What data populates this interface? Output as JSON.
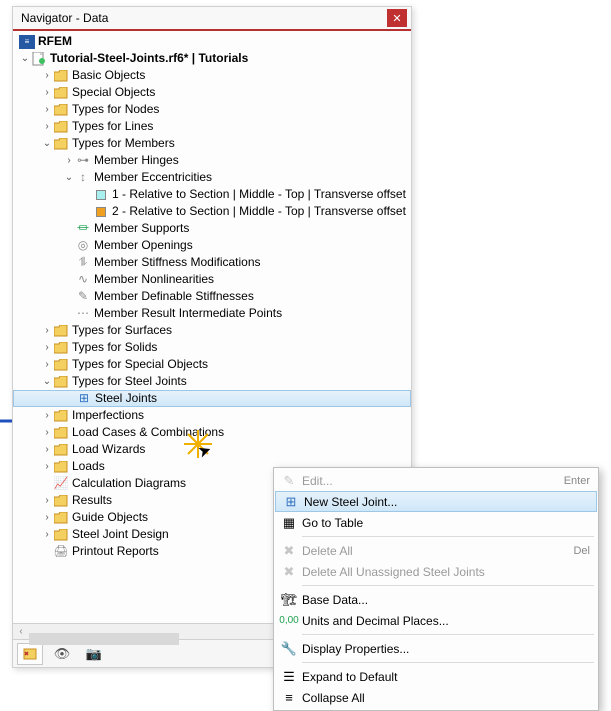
{
  "window": {
    "title": "Navigator - Data"
  },
  "tree": {
    "root_app": "RFEM",
    "project": "Tutorial-Steel-Joints.rf6* | Tutorials",
    "items": {
      "basic_objects": "Basic Objects",
      "special_objects": "Special Objects",
      "types_nodes": "Types for Nodes",
      "types_lines": "Types for Lines",
      "types_members": "Types for Members",
      "member_hinges": "Member Hinges",
      "member_ecc": "Member Eccentricities",
      "ecc1": "1 - Relative to Section | Middle - Top | Transverse offset",
      "ecc2": "2 - Relative to Section | Middle - Top | Transverse offset",
      "member_supports": "Member Supports",
      "member_openings": "Member Openings",
      "member_stiff_mod": "Member Stiffness Modifications",
      "member_nonlin": "Member Nonlinearities",
      "member_def_stiff": "Member Definable Stiffnesses",
      "member_res_int": "Member Result Intermediate Points",
      "types_surfaces": "Types for Surfaces",
      "types_solids": "Types for Solids",
      "types_special": "Types for Special Objects",
      "types_steel_joints": "Types for Steel Joints",
      "steel_joints": "Steel Joints",
      "imperfections": "Imperfections",
      "load_cases": "Load Cases & Combinations",
      "load_wizards": "Load Wizards",
      "loads": "Loads",
      "calc_diagrams": "Calculation Diagrams",
      "results": "Results",
      "guide_objects": "Guide Objects",
      "steel_joint_design": "Steel Joint Design",
      "printout_reports": "Printout Reports"
    }
  },
  "context_menu": {
    "edit": {
      "label": "Edit...",
      "accel": "Enter"
    },
    "new_joint": {
      "label": "New Steel Joint..."
    },
    "go_table": {
      "label": "Go to Table"
    },
    "delete_all": {
      "label": "Delete All",
      "accel": "Del"
    },
    "delete_unassigned": {
      "label": "Delete All Unassigned Steel Joints"
    },
    "base_data": {
      "label": "Base Data..."
    },
    "units": {
      "label": "Units and Decimal Places..."
    },
    "display_props": {
      "label": "Display Properties..."
    },
    "expand": {
      "label": "Expand to Default"
    },
    "collapse": {
      "label": "Collapse All"
    }
  }
}
